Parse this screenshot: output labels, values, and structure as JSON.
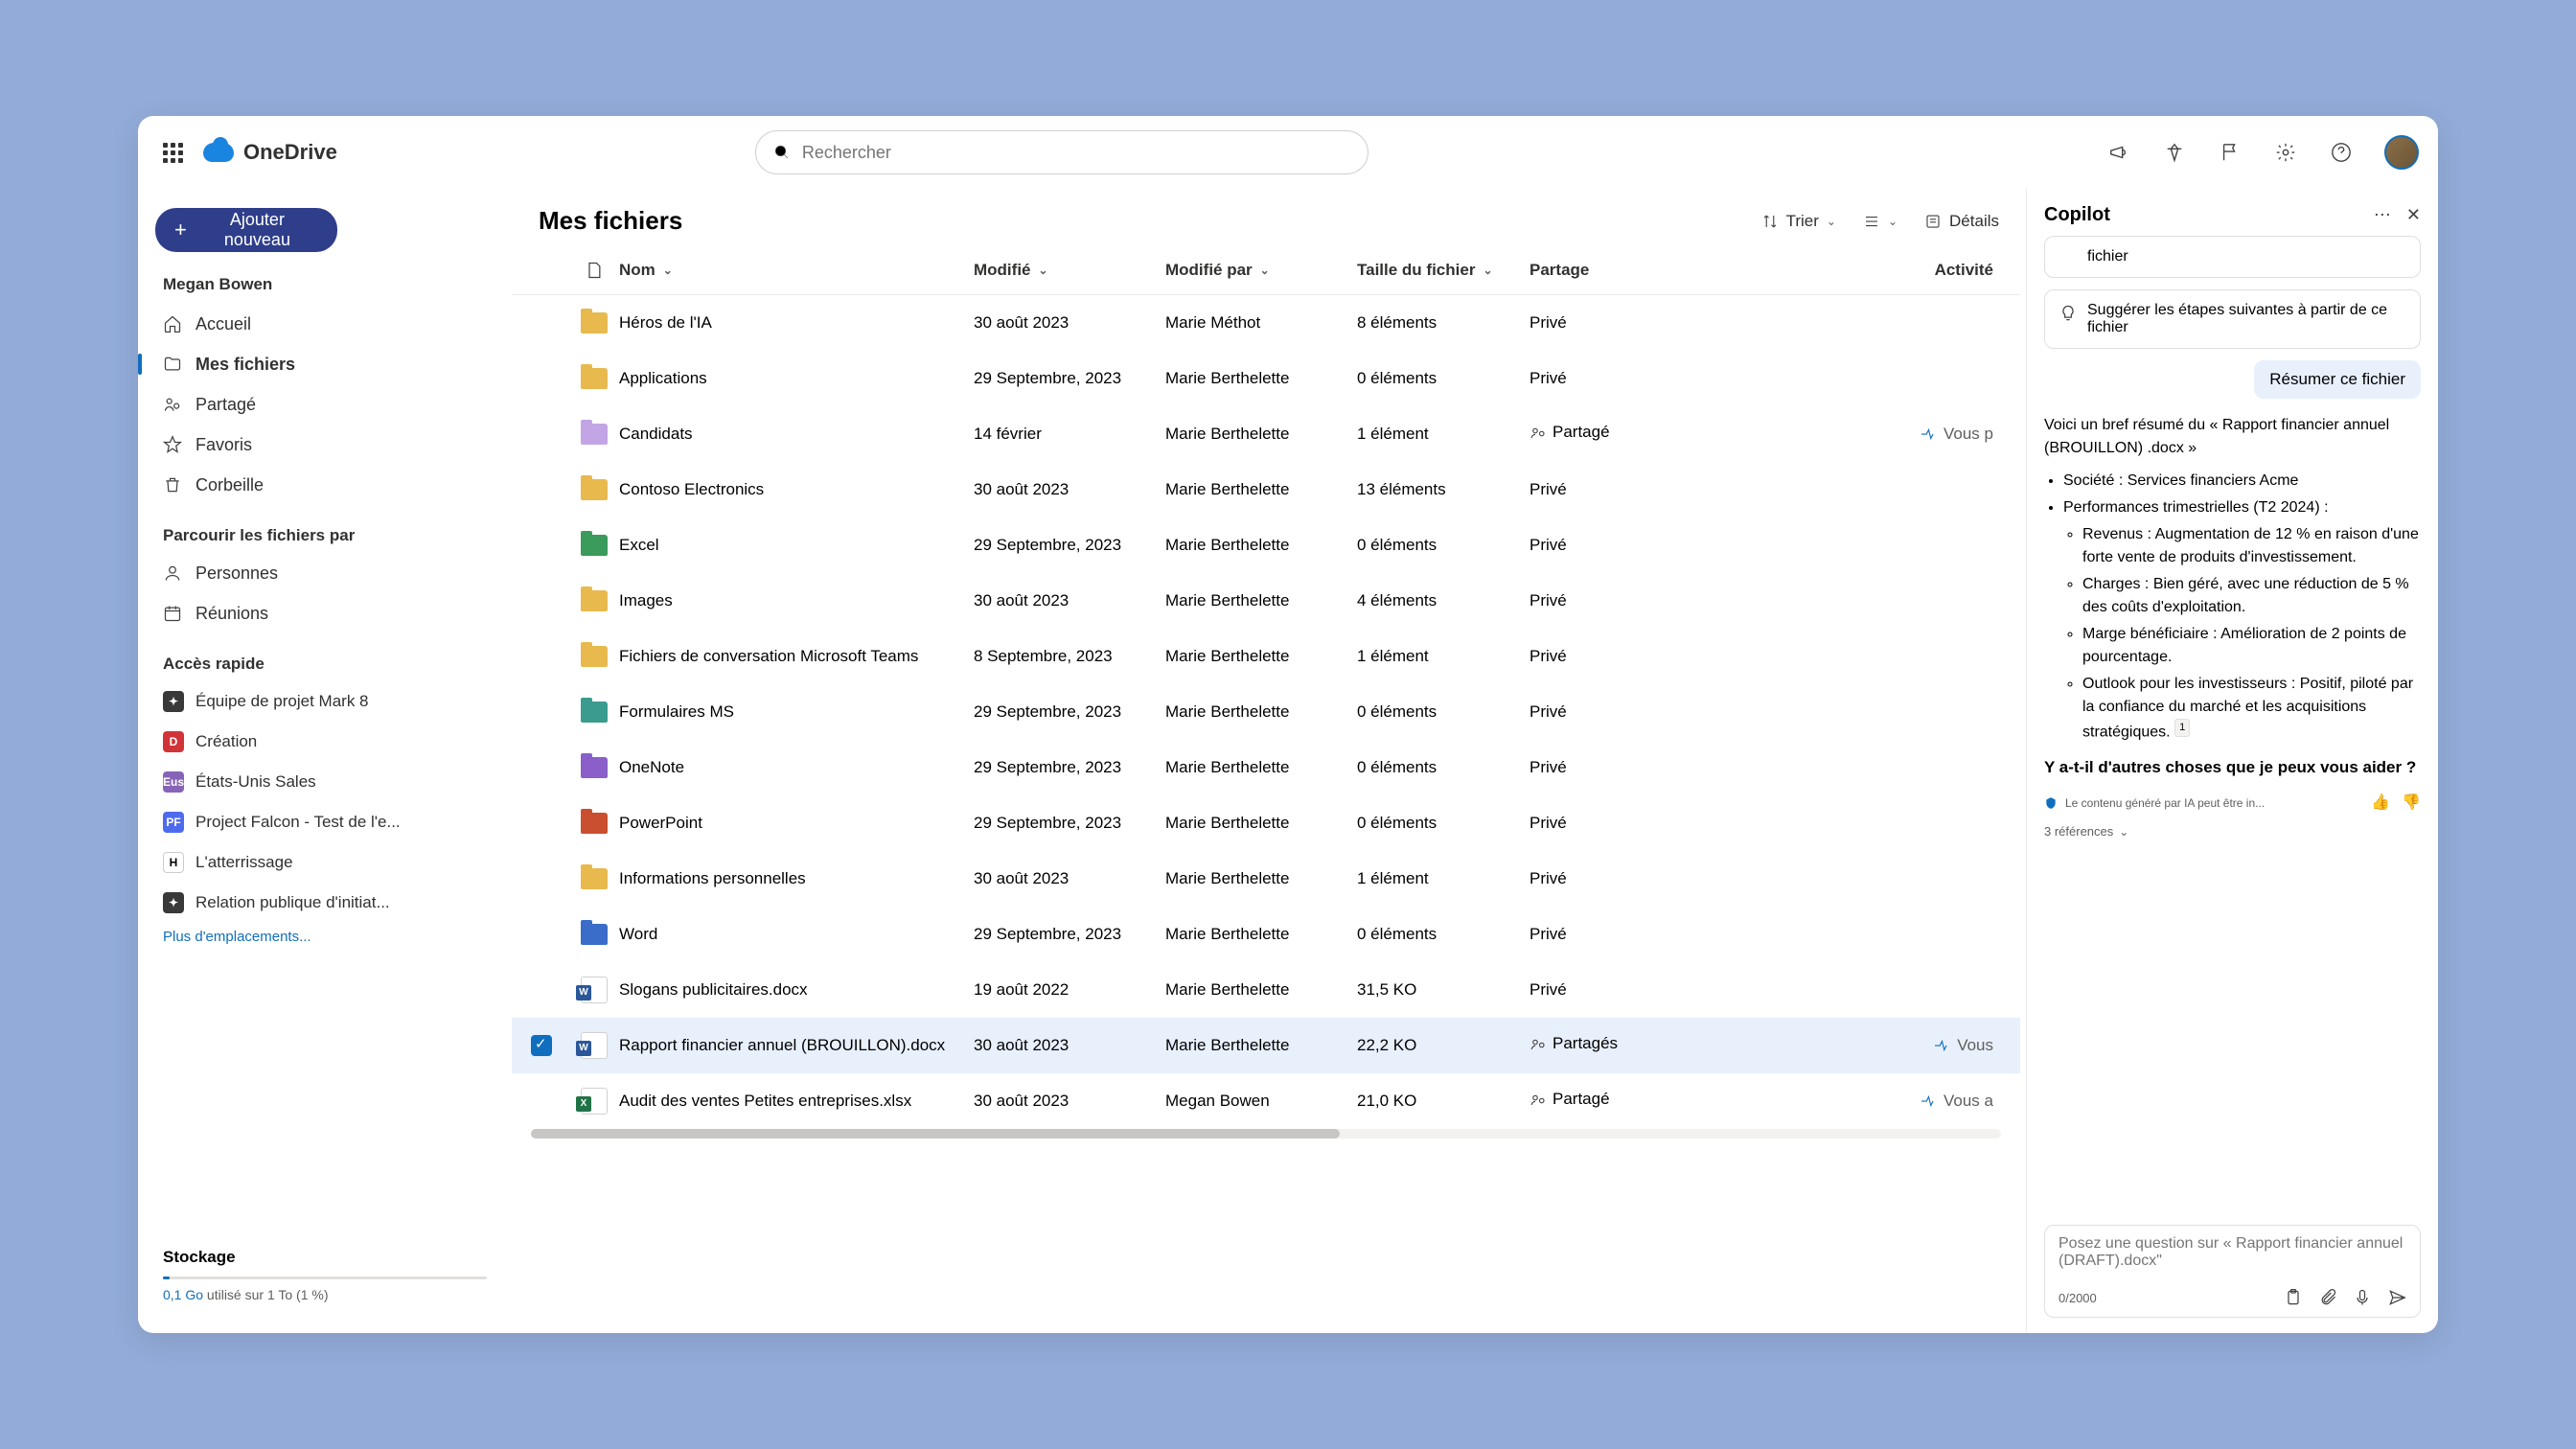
{
  "header": {
    "app_name": "OneDrive",
    "search_placeholder": "Rechercher"
  },
  "sidebar": {
    "add_button": "Ajouter nouveau",
    "user_name": "Megan Bowen",
    "nav": [
      {
        "label": "Accueil"
      },
      {
        "label": "Mes fichiers"
      },
      {
        "label": "Partagé"
      },
      {
        "label": "Favoris"
      },
      {
        "label": "Corbeille"
      }
    ],
    "browse_title": "Parcourir les fichiers par",
    "browse": [
      {
        "label": "Personnes"
      },
      {
        "label": "Réunions"
      }
    ],
    "quick_title": "Accès rapide",
    "quick": [
      {
        "label": "Équipe de projet Mark 8",
        "color": "#393939",
        "init": "✦"
      },
      {
        "label": "Création",
        "color": "#d13438",
        "init": "D"
      },
      {
        "label": "États-Unis Sales",
        "color": "#8764b8",
        "init": "Eus"
      },
      {
        "label": "Project Falcon - Test de l'e...",
        "color": "#4f6bed",
        "init": "PF"
      },
      {
        "label": "L'atterrissage",
        "color": "#ffffff",
        "init": "H",
        "fg": "#000"
      },
      {
        "label": "Relation publique d'initiat...",
        "color": "#393939",
        "init": "✦"
      }
    ],
    "more": "Plus d'emplacements...",
    "storage_title": "Stockage",
    "storage_size": "0,1 Go",
    "storage_text": "utilisé sur 1 To (1 %)"
  },
  "main": {
    "title": "Mes fichiers",
    "sort": "Trier",
    "details": "Détails",
    "columns": {
      "name": "Nom",
      "modified": "Modifié",
      "modified_by": "Modifié par",
      "size": "Taille du fichier",
      "sharing": "Partage",
      "activity": "Activité"
    },
    "rows": [
      {
        "type": "folder",
        "color": "#e8b94d",
        "name": "Héros de l'IA",
        "mod": "30 août 2023",
        "by": "Marie Méthot",
        "size": "8 éléments",
        "share": "Privé"
      },
      {
        "type": "folder",
        "color": "#e8b94d",
        "name": "Applications",
        "mod": "29 Septembre, 2023",
        "by": "Marie Berthelette",
        "size": "0 éléments",
        "share": "Privé"
      },
      {
        "type": "folder",
        "color": "#c3a5e6",
        "name": "Candidats",
        "mod": "14 février",
        "by": "Marie Berthelette",
        "size": "1 élément",
        "share": "Partagé",
        "share_icon": true,
        "activity": "Vous p"
      },
      {
        "type": "folder",
        "color": "#e8b94d",
        "name": "Contoso Electronics",
        "mod": "30 août 2023",
        "by": "Marie Berthelette",
        "size": "13 éléments",
        "share": "Privé"
      },
      {
        "type": "folder",
        "color": "#3a9b5c",
        "name": "Excel",
        "mod": "29 Septembre, 2023",
        "by": "Marie Berthelette",
        "size": "0 éléments",
        "share": "Privé"
      },
      {
        "type": "folder",
        "color": "#e8b94d",
        "name": "Images",
        "mod": "30 août 2023",
        "by": "Marie Berthelette",
        "size": "4 éléments",
        "share": "Privé"
      },
      {
        "type": "folder",
        "color": "#e8b94d",
        "name": "Fichiers de conversation Microsoft Teams",
        "mod": "8 Septembre, 2023",
        "by": "Marie Berthelette",
        "size": "1 élément",
        "share": "Privé"
      },
      {
        "type": "folder",
        "color": "#3a9b8f",
        "name": "Formulaires MS",
        "mod": "29 Septembre, 2023",
        "by": "Marie Berthelette",
        "size": "0 éléments",
        "share": "Privé"
      },
      {
        "type": "folder",
        "color": "#8a5fc9",
        "name": "OneNote",
        "mod": "29 Septembre, 2023",
        "by": "Marie Berthelette",
        "size": "0 éléments",
        "share": "Privé"
      },
      {
        "type": "folder",
        "color": "#c94f2f",
        "name": "PowerPoint",
        "mod": "29 Septembre, 2023",
        "by": "Marie Berthelette",
        "size": "0 éléments",
        "share": "Privé"
      },
      {
        "type": "folder",
        "color": "#e8b94d",
        "name": "Informations personnelles",
        "mod": "30 août 2023",
        "by": "Marie Berthelette",
        "size": "1 élément",
        "share": "Privé"
      },
      {
        "type": "folder",
        "color": "#3a6cc9",
        "name": "Word",
        "mod": "29 Septembre, 2023",
        "by": "Marie Berthelette",
        "size": "0 éléments",
        "share": "Privé"
      },
      {
        "type": "docx",
        "name": "Slogans publicitaires.docx",
        "mod": "19 août 2022",
        "by": "Marie Berthelette",
        "size": "31,5 KO",
        "share": "Privé"
      },
      {
        "type": "docx",
        "selected": true,
        "name": "Rapport financier annuel (BROUILLON).docx",
        "mod": "30 août 2023",
        "by": "Marie Berthelette",
        "size": "22,2 KO",
        "share": "Partagés",
        "share_icon": true,
        "activity": "Vous"
      },
      {
        "type": "xlsx",
        "name": "Audit des ventes Petites entreprises.xlsx",
        "mod": "30 août 2023",
        "by": "Megan Bowen",
        "size": "21,0 KO",
        "share": "Partagé",
        "share_icon": true,
        "activity": "Vous a"
      }
    ]
  },
  "copilot": {
    "title": "Copilot",
    "suggestion1": "fichier",
    "suggestion2": "Suggérer les étapes suivantes à partir de ce fichier",
    "user_msg": "Résumer ce fichier",
    "intro": "Voici un bref résumé du « Rapport financier annuel (BROUILLON) .docx »",
    "b1": "Société : Services financiers Acme",
    "b2": "Performances trimestrielles (T2 2024) :",
    "b2a": "Revenus : Augmentation de 12 % en raison d'une forte vente de produits d'investissement.",
    "b2b": "Charges : Bien géré, avec une réduction de 5 % des coûts d'exploitation.",
    "b2c": "Marge bénéficiaire : Amélioration de 2 points de pourcentage.",
    "b2d": "Outlook pour les investisseurs : Positif, piloté par la confiance du marché et les acquisitions stratégiques.",
    "followup": "Y a-t-il d'autres choses que je peux vous aider ?",
    "disclaimer": "Le contenu généré par IA peut être in...",
    "refs": "3 références",
    "input_placeholder": "Posez une question sur « Rapport financier annuel (DRAFT).docx\"",
    "char_count": "0/2000"
  }
}
